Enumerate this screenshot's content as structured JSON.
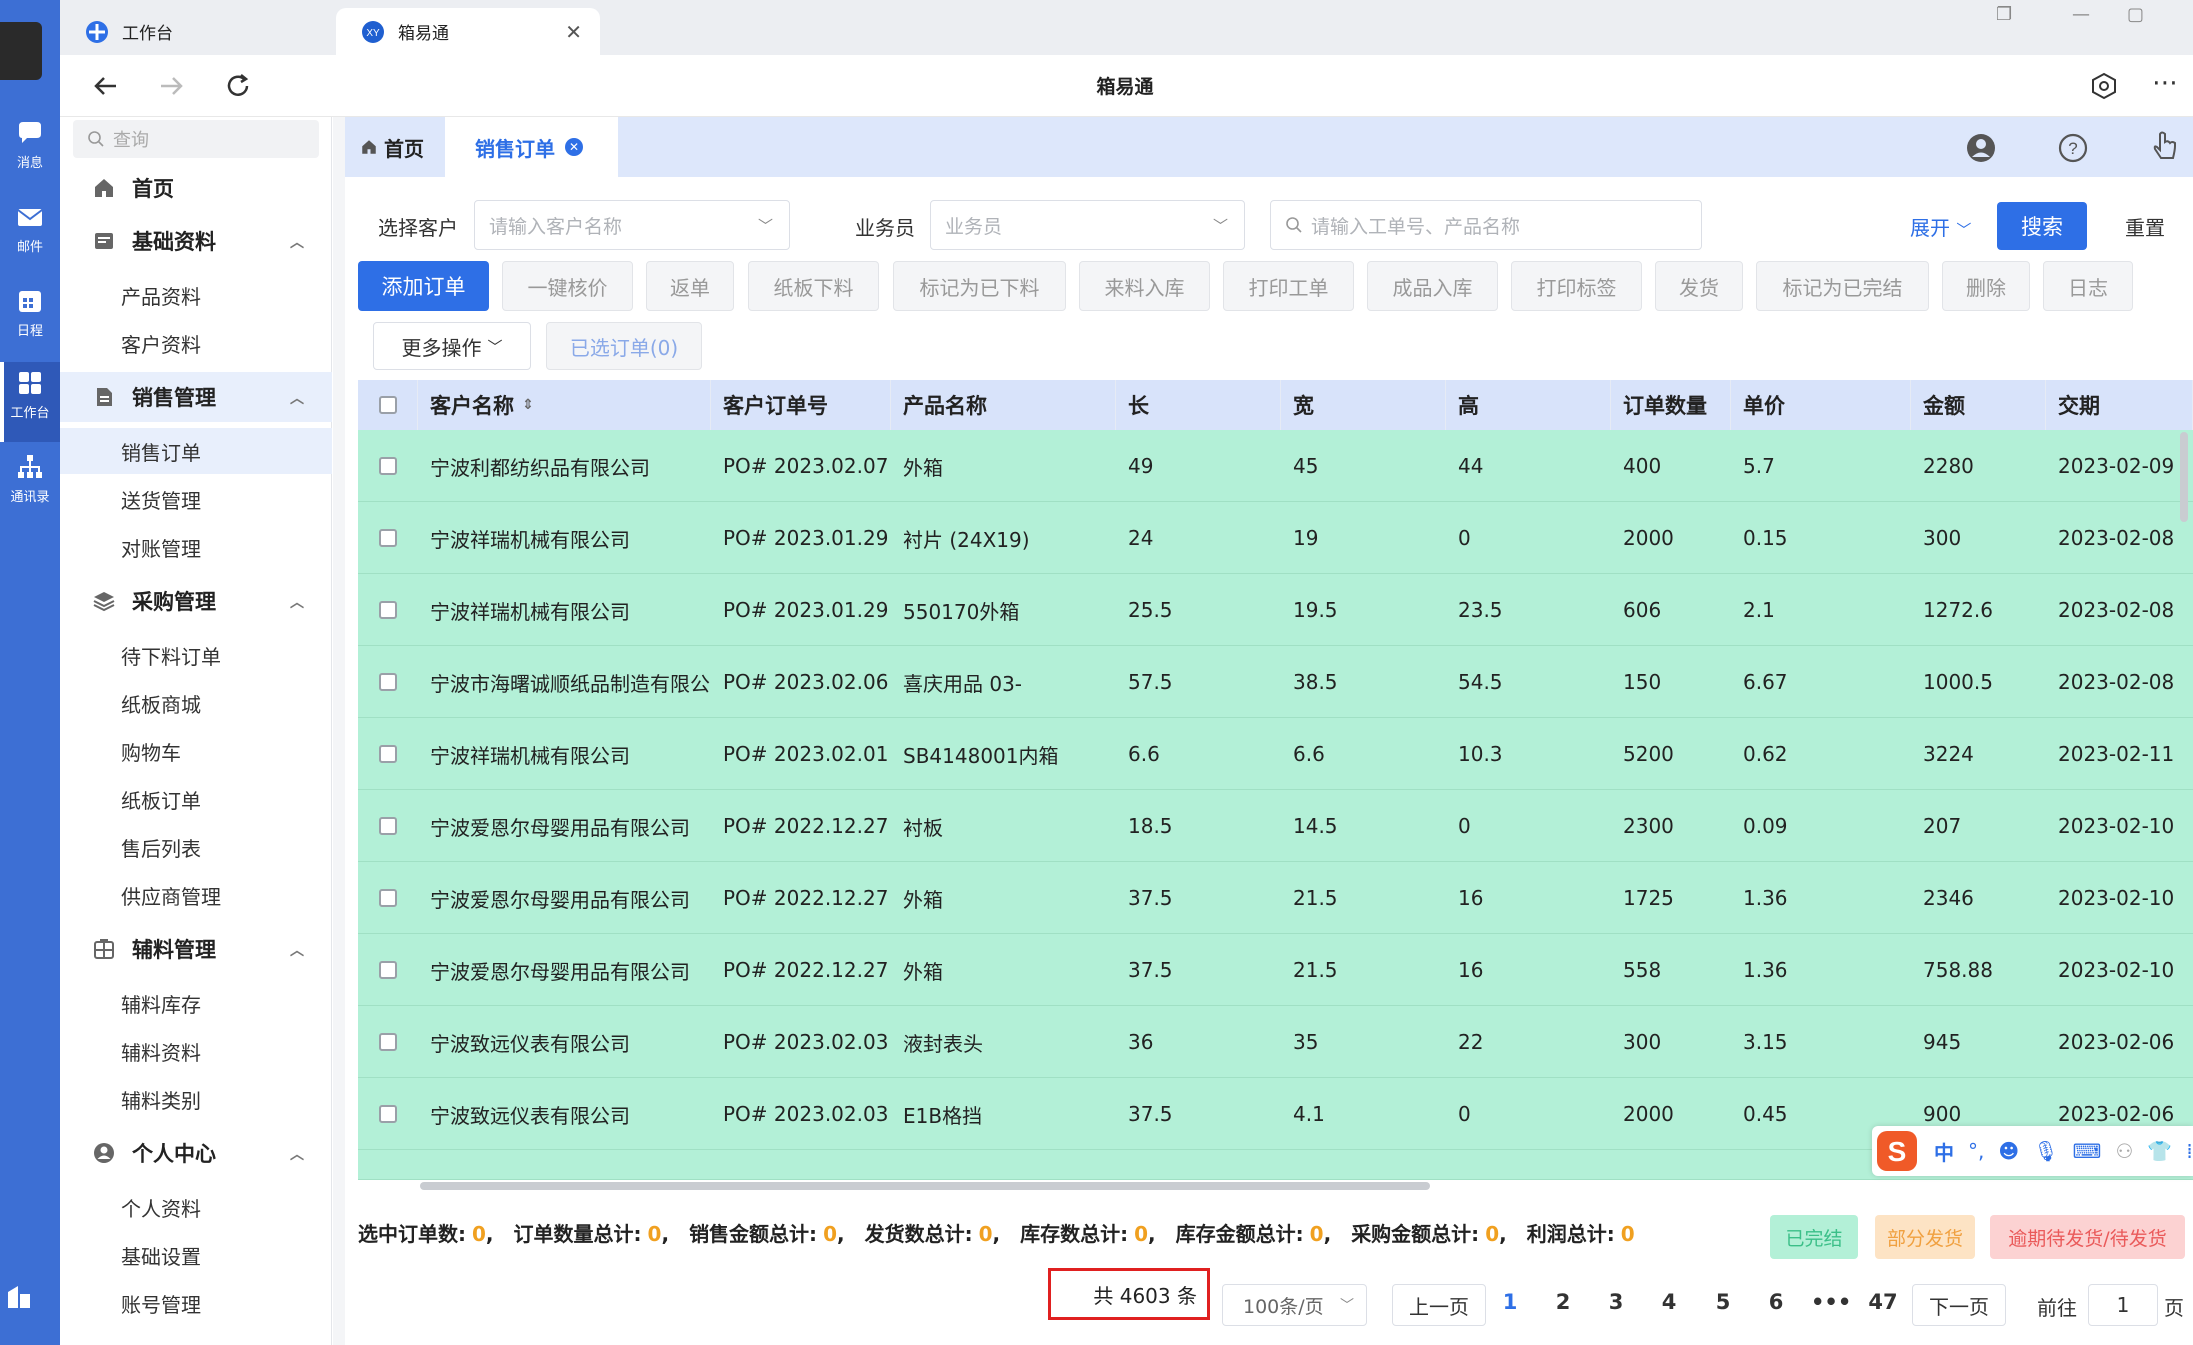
{
  "dock": {
    "items": [
      {
        "label": "消息"
      },
      {
        "label": "邮件"
      },
      {
        "label": "日程"
      },
      {
        "label": "工作台"
      },
      {
        "label": "通讯录"
      }
    ]
  },
  "browser": {
    "tabs": [
      {
        "label": "工作台",
        "icon": "workbench-icon"
      },
      {
        "label": "箱易通",
        "icon": "app-logo-icon"
      }
    ],
    "title": "箱易通"
  },
  "sidebar": {
    "search_placeholder": "查询",
    "home": "首页",
    "groups": [
      {
        "label": "基础资料",
        "icon": "document-icon",
        "items": [
          "产品资料",
          "客户资料"
        ]
      },
      {
        "label": "销售管理",
        "icon": "file-icon",
        "items": [
          "销售订单",
          "送货管理",
          "对账管理"
        ]
      },
      {
        "label": "采购管理",
        "icon": "layers-icon",
        "items": [
          "待下料订单",
          "纸板商城",
          "购物车",
          "纸板订单",
          "售后列表",
          "供应商管理"
        ]
      },
      {
        "label": "辅料管理",
        "icon": "grid-box-icon",
        "items": [
          "辅料库存",
          "辅料资料",
          "辅料类别"
        ]
      },
      {
        "label": "个人中心",
        "icon": "user-icon",
        "items": [
          "个人资料",
          "基础设置",
          "账号管理"
        ]
      }
    ]
  },
  "page_tabs": {
    "home": "首页",
    "active": "销售订单"
  },
  "filters": {
    "customer_label": "选择客户",
    "customer_placeholder": "请输入客户名称",
    "salesman_label": "业务员",
    "salesman_placeholder": "业务员",
    "keyword_placeholder": "请输入工单号、产品名称",
    "expand": "展开",
    "search": "搜索",
    "reset": "重置"
  },
  "actions": {
    "primary": "添加订单",
    "buttons": [
      "一键核价",
      "返单",
      "纸板下料",
      "标记为已下料",
      "来料入库",
      "打印工单",
      "成品入库",
      "打印标签",
      "发货",
      "标记为已完结",
      "删除",
      "日志"
    ],
    "more": "更多操作",
    "selected": "已选订单(0)"
  },
  "table": {
    "columns": [
      "客户名称",
      "客户订单号",
      "产品名称",
      "长",
      "宽",
      "高",
      "订单数量",
      "单价",
      "金额",
      "交期"
    ],
    "rows": [
      [
        "宁波利都纺织品有限公司",
        "PO# 2023.02.07",
        "外箱",
        "49",
        "45",
        "44",
        "400",
        "5.7",
        "2280",
        "2023-02-09"
      ],
      [
        "宁波祥瑞机械有限公司",
        "PO# 2023.01.29",
        "衬片 (24X19)",
        "24",
        "19",
        "0",
        "2000",
        "0.15",
        "300",
        "2023-02-08"
      ],
      [
        "宁波祥瑞机械有限公司",
        "PO# 2023.01.29",
        "550170外箱",
        "25.5",
        "19.5",
        "23.5",
        "606",
        "2.1",
        "1272.6",
        "2023-02-08"
      ],
      [
        "宁波市海曙诚顺纸品制造有限公司",
        "PO# 2023.02.06",
        "喜庆用品 03-",
        "57.5",
        "38.5",
        "54.5",
        "150",
        "6.67",
        "1000.5",
        "2023-02-08"
      ],
      [
        "宁波祥瑞机械有限公司",
        "PO# 2023.02.01",
        "SB4148001内箱",
        "6.6",
        "6.6",
        "10.3",
        "5200",
        "0.62",
        "3224",
        "2023-02-11"
      ],
      [
        "宁波爱恩尔母婴用品有限公司",
        "PO# 2022.12.27",
        "衬板",
        "18.5",
        "14.5",
        "0",
        "2300",
        "0.09",
        "207",
        "2023-02-10"
      ],
      [
        "宁波爱恩尔母婴用品有限公司",
        "PO# 2022.12.27",
        "外箱",
        "37.5",
        "21.5",
        "16",
        "1725",
        "1.36",
        "2346",
        "2023-02-10"
      ],
      [
        "宁波爱恩尔母婴用品有限公司",
        "PO# 2022.12.27",
        "外箱",
        "37.5",
        "21.5",
        "16",
        "558",
        "1.36",
        "758.88",
        "2023-02-10"
      ],
      [
        "宁波致远仪表有限公司",
        "PO# 2023.02.03",
        "液封表头",
        "36",
        "35",
        "22",
        "300",
        "3.15",
        "945",
        "2023-02-06"
      ],
      [
        "宁波致远仪表有限公司",
        "PO# 2023.02.03",
        "E1B格挡",
        "37.5",
        "4.1",
        "0",
        "2000",
        "0.45",
        "900",
        "2023-02-06"
      ]
    ]
  },
  "summary": [
    {
      "label": "选中订单数:",
      "value": "0"
    },
    {
      "label": "订单数量总计:",
      "value": "0"
    },
    {
      "label": "销售金额总计:",
      "value": "0"
    },
    {
      "label": "发货数总计:",
      "value": "0"
    },
    {
      "label": "库存数总计:",
      "value": "0"
    },
    {
      "label": "库存金额总计:",
      "value": "0"
    },
    {
      "label": "采购金额总计:",
      "value": "0"
    },
    {
      "label": "利润总计:",
      "value": "0"
    }
  ],
  "legend": [
    {
      "label": "已完结",
      "bg": "#b3f0d7",
      "color": "#3bbf88"
    },
    {
      "label": "部分发货",
      "bg": "#fde3c4",
      "color": "#f0a040"
    },
    {
      "label": "逾期待发货/待发货",
      "bg": "#fcd2d2",
      "color": "#ea5a5a"
    }
  ],
  "pagination": {
    "total": "共 4603 条",
    "page_size": "100条/页",
    "prev": "上一页",
    "next": "下一页",
    "pages": [
      "1",
      "2",
      "3",
      "4",
      "5",
      "6",
      "•••",
      "47"
    ],
    "current": "1",
    "goto_label": "前往",
    "goto_value": "1",
    "goto_suffix": "页"
  },
  "ime": {
    "mode": "中"
  },
  "colors": {
    "accent": "#2e6fe6",
    "dock": "#3d6fd4",
    "row_completed": "#b3f0d7",
    "header": "#d8e3fa"
  }
}
